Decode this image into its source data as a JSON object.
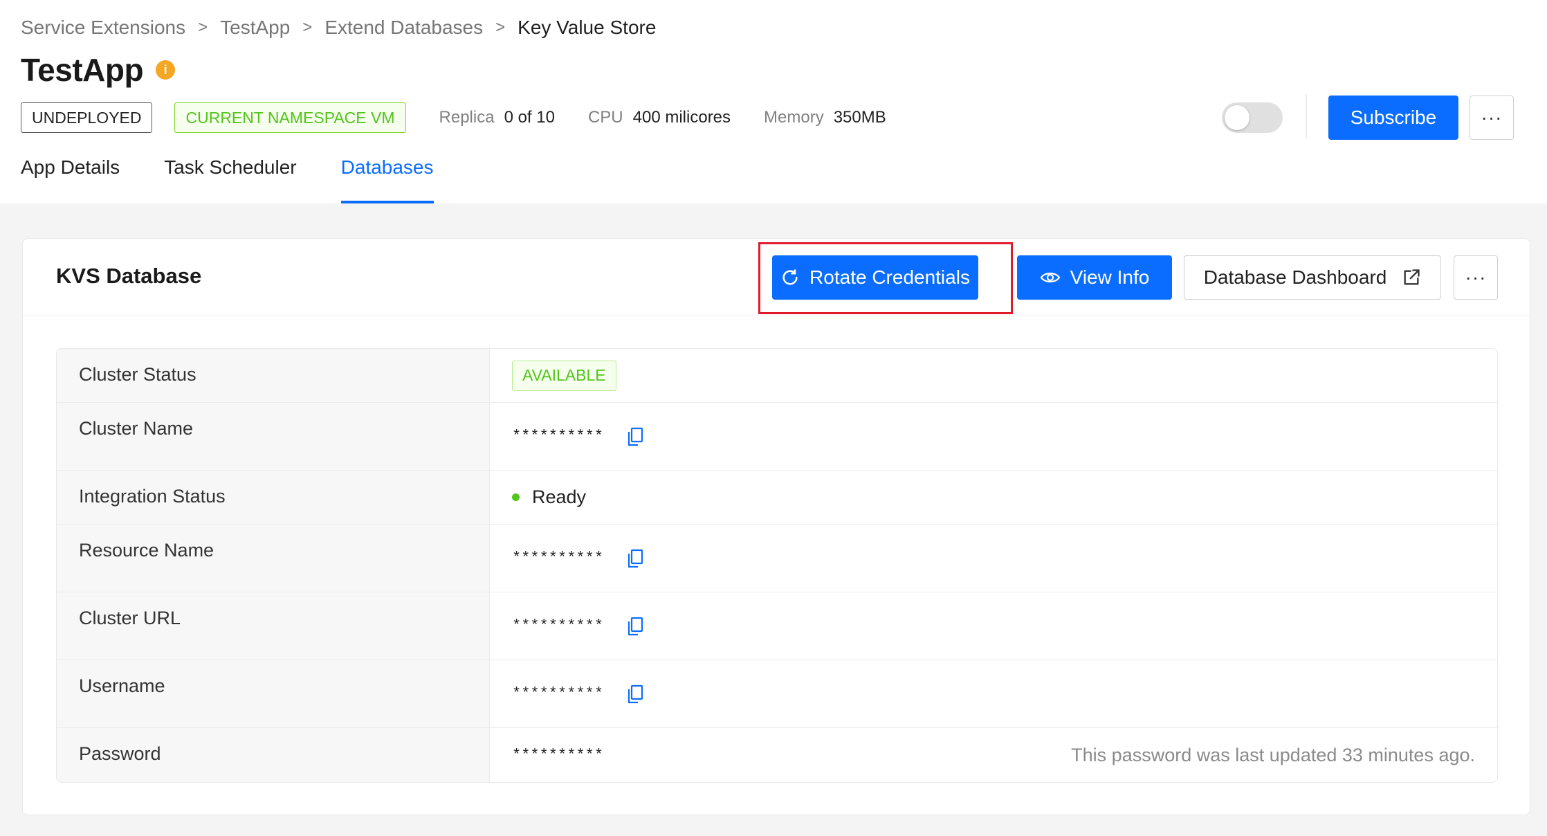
{
  "breadcrumb": {
    "items": [
      "Service Extensions",
      "TestApp",
      "Extend Databases"
    ],
    "current": "Key Value Store",
    "separator": ">"
  },
  "header": {
    "title": "TestApp",
    "info_icon": "i",
    "status_tag": "UNDEPLOYED",
    "namespace_tag": "CURRENT NAMESPACE VM",
    "replica_label": "Replica",
    "replica_value": "0 of 10",
    "cpu_label": "CPU",
    "cpu_value": "400 milicores",
    "memory_label": "Memory",
    "memory_value": "350MB",
    "toggle_on": false,
    "subscribe_label": "Subscribe",
    "more_label": "···"
  },
  "tabs": [
    {
      "label": "App Details",
      "active": false
    },
    {
      "label": "Task Scheduler",
      "active": false
    },
    {
      "label": "Databases",
      "active": true
    }
  ],
  "card": {
    "title": "KVS Database",
    "rotate_label": "Rotate Credentials",
    "view_info_label": "View Info",
    "dashboard_label": "Database Dashboard",
    "more_label": "···"
  },
  "details": {
    "cluster_status": {
      "label": "Cluster Status",
      "value": "AVAILABLE"
    },
    "cluster_name": {
      "label": "Cluster Name",
      "value": "**********"
    },
    "integration_status": {
      "label": "Integration Status",
      "value": "Ready"
    },
    "resource_name": {
      "label": "Resource Name",
      "value": "**********"
    },
    "cluster_url": {
      "label": "Cluster URL",
      "value": "**********"
    },
    "username": {
      "label": "Username",
      "value": "**********"
    },
    "password": {
      "label": "Password",
      "value": "**********",
      "note": "This password was last updated 33 minutes ago."
    }
  },
  "colors": {
    "primary": "#0a6dff",
    "success": "#52c41a",
    "warning": "#f5a623",
    "highlight": "#e21b2c"
  },
  "icons": [
    "info-icon",
    "refresh-icon",
    "eye-icon",
    "external-link-icon",
    "copy-icon",
    "more-icon"
  ]
}
